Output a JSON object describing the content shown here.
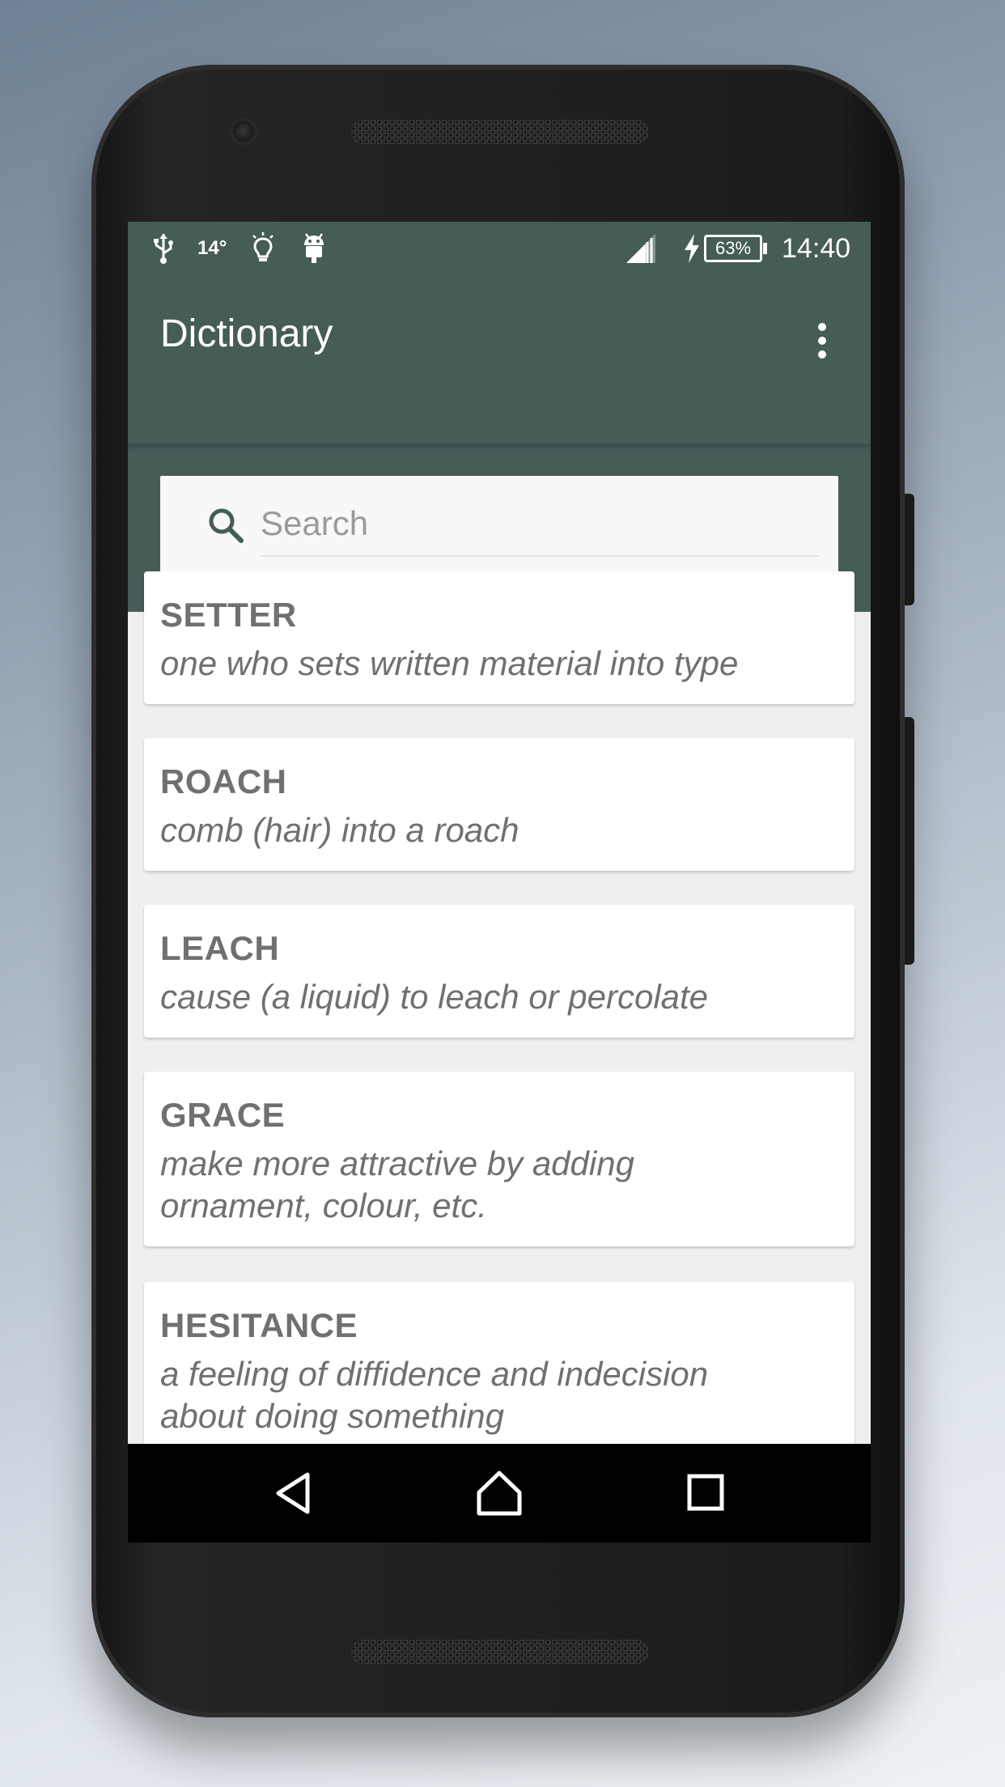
{
  "status_bar": {
    "temperature": "14°",
    "battery": "63%",
    "time": "14:40",
    "icons": [
      "usb-icon",
      "lightbulb-icon",
      "android-icon",
      "signal-icon",
      "charging-icon",
      "battery-icon"
    ]
  },
  "app_bar": {
    "title": "Dictionary",
    "menu_icon": "more-vert-icon"
  },
  "search": {
    "placeholder": "Search",
    "icon": "search-icon"
  },
  "entries": [
    {
      "word": "SETTER",
      "definition_lines": [
        "one who sets written material into type"
      ]
    },
    {
      "word": "ROACH",
      "definition_lines": [
        "comb (hair) into a roach"
      ]
    },
    {
      "word": "LEACH",
      "definition_lines": [
        "cause (a liquid) to leach or percolate"
      ]
    },
    {
      "word": "GRACE",
      "definition_lines": [
        "make more attractive by adding",
        "ornament, colour, etc."
      ]
    },
    {
      "word": "HESITANCE",
      "definition_lines": [
        "a feeling of diffidence and indecision",
        "about doing something"
      ]
    }
  ],
  "nav_bar": {
    "buttons": [
      "back-icon",
      "home-icon",
      "recents-icon"
    ]
  },
  "colors": {
    "primary": "#465c57",
    "background": "#efefef",
    "card": "#ffffff",
    "text": "#707070"
  }
}
